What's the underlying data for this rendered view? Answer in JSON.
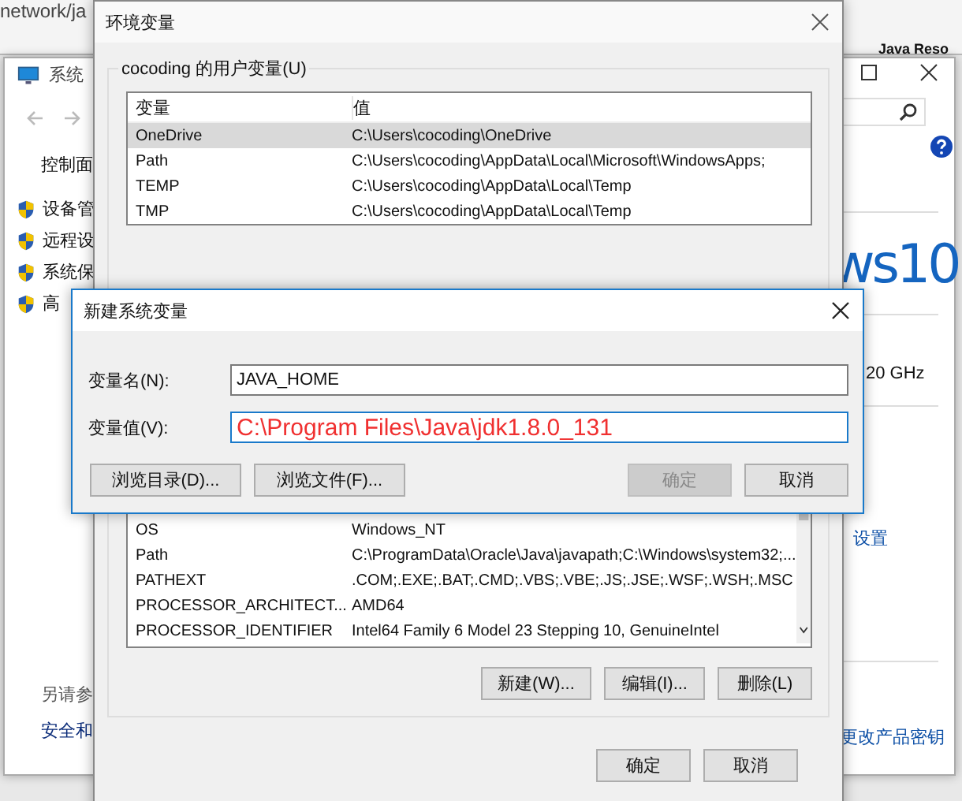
{
  "background_window": {
    "address": "network/ja",
    "tab_label": "Java Reso"
  },
  "system_window": {
    "title": "系统",
    "breadcrumb": "控制面",
    "side_links": [
      "设备管",
      "远程设",
      "系统保",
      "高"
    ],
    "see_also": "另请参",
    "security_link": "安全和",
    "logo_text": "ws10",
    "processor_speed": "20 GHz",
    "change_settings_link": "设置",
    "product_key_link": "更改产品密钥"
  },
  "env_dialog": {
    "title": "环境变量",
    "user_group": "cocoding 的用户变量(U)",
    "columns": [
      "变量",
      "值"
    ],
    "user_rows": [
      {
        "name": "OneDrive",
        "value": "C:\\Users\\cocoding\\OneDrive",
        "selected": true
      },
      {
        "name": "Path",
        "value": "C:\\Users\\cocoding\\AppData\\Local\\Microsoft\\WindowsApps;",
        "selected": false
      },
      {
        "name": "TEMP",
        "value": "C:\\Users\\cocoding\\AppData\\Local\\Temp",
        "selected": false
      },
      {
        "name": "TMP",
        "value": "C:\\Users\\cocoding\\AppData\\Local\\Temp",
        "selected": false
      }
    ],
    "system_rows": [
      {
        "name": "OS",
        "value": "Windows_NT",
        "selected": false
      },
      {
        "name": "Path",
        "value": "C:\\ProgramData\\Oracle\\Java\\javapath;C:\\Windows\\system32;...",
        "selected": false
      },
      {
        "name": "PATHEXT",
        "value": ".COM;.EXE;.BAT;.CMD;.VBS;.VBE;.JS;.JSE;.WSF;.WSH;.MSC",
        "selected": false
      },
      {
        "name": "PROCESSOR_ARCHITECT...",
        "value": "AMD64",
        "selected": false
      },
      {
        "name": "PROCESSOR_IDENTIFIER",
        "value": "Intel64 Family 6 Model 23 Stepping 10, GenuineIntel",
        "selected": false
      }
    ],
    "system_buttons": [
      "新建(W)...",
      "编辑(I)...",
      "删除(L)"
    ],
    "buttons": [
      "确定",
      "取消"
    ]
  },
  "new_dialog": {
    "title": "新建系统变量",
    "name_label": "变量名(N):",
    "name_value": "JAVA_HOME",
    "value_label": "变量值(V):",
    "value_value": "C:\\Program Files\\Java\\jdk1.8.0_131",
    "buttons": [
      {
        "label": "浏览目录(D)...",
        "disabled": false
      },
      {
        "label": "浏览文件(F)...",
        "disabled": false
      },
      {
        "label": "确定",
        "disabled": true
      },
      {
        "label": "取消",
        "disabled": false
      }
    ]
  }
}
